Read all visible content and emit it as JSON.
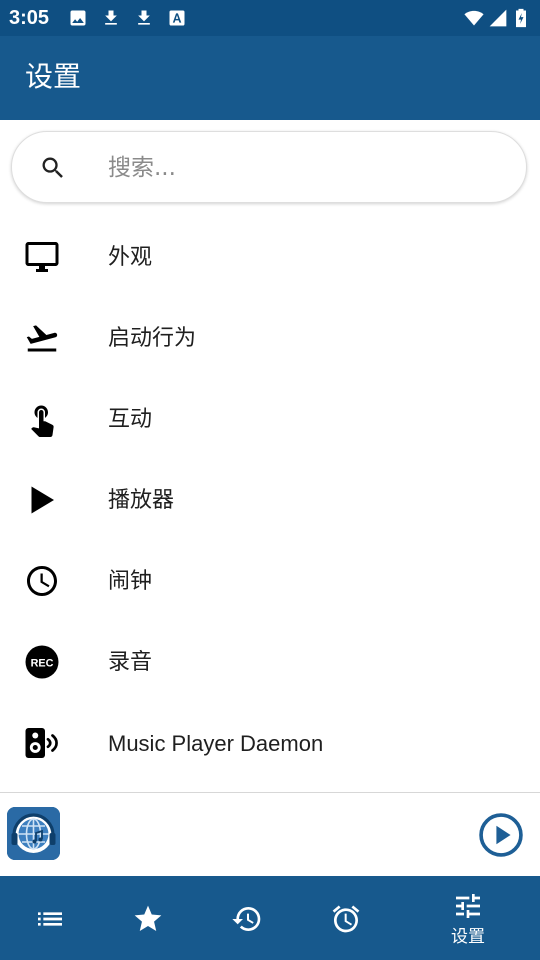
{
  "status_bar": {
    "time": "3:05",
    "icons": [
      "image-icon",
      "download-icon",
      "download-icon",
      "font-app-icon",
      "wifi-icon",
      "signal-icon",
      "battery-charging-icon"
    ]
  },
  "app_bar": {
    "title": "设置"
  },
  "search": {
    "placeholder": "搜索..."
  },
  "settings": {
    "items": [
      {
        "label": "外观",
        "icon": "monitor-icon"
      },
      {
        "label": "启动行为",
        "icon": "flight-takeoff-icon"
      },
      {
        "label": "互动",
        "icon": "touch-icon"
      },
      {
        "label": "播放器",
        "icon": "play-arrow-icon"
      },
      {
        "label": "闹钟",
        "icon": "clock-icon"
      },
      {
        "label": "录音",
        "icon": "rec-icon"
      },
      {
        "label": "Music Player Daemon",
        "icon": "speaker-icon"
      }
    ]
  },
  "mini_player": {
    "logo_icon": "station-globe-logo",
    "play_icon": "play-circle-icon"
  },
  "bottom_nav": {
    "items": [
      {
        "icon": "list-icon",
        "label": ""
      },
      {
        "icon": "star-icon",
        "label": ""
      },
      {
        "icon": "history-icon",
        "label": ""
      },
      {
        "icon": "alarm-icon",
        "label": ""
      },
      {
        "icon": "tune-icon",
        "label": "设置",
        "active": true
      }
    ]
  },
  "colors": {
    "status_bar": "#0f4f82",
    "app_bar": "#17598d",
    "accent": "#1e5f96",
    "text_primary": "#1f1f1f",
    "text_hint": "#8a8a8a"
  }
}
